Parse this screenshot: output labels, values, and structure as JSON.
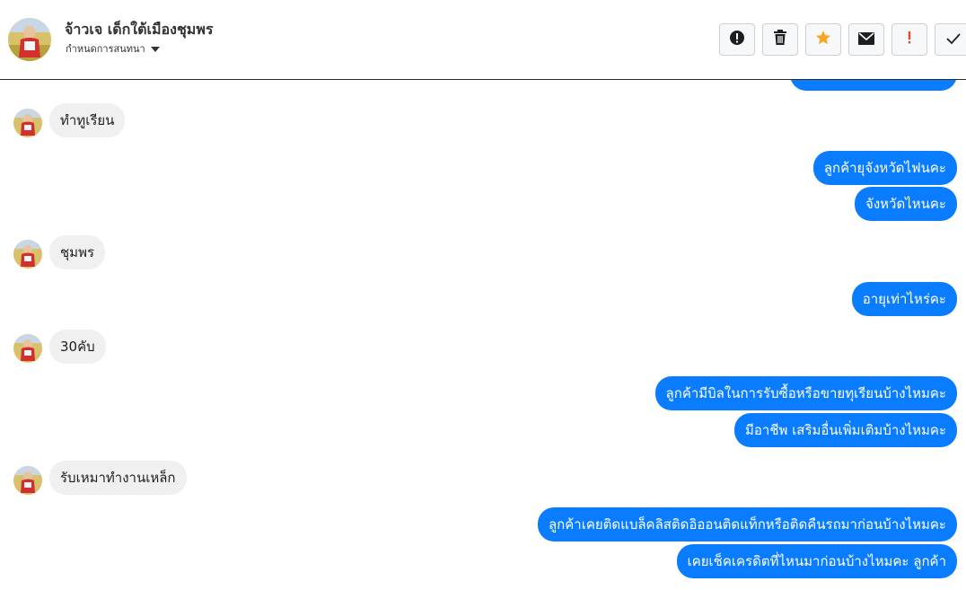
{
  "header": {
    "contact_name": "จ้าวเจ เด็กใต้เมืองชุมพร",
    "assign_label": "กำหนดการสนทนา"
  },
  "toolbar": {
    "buttons": [
      {
        "name": "alert-circle-icon"
      },
      {
        "name": "trash-icon"
      },
      {
        "name": "star-icon"
      },
      {
        "name": "envelope-icon"
      },
      {
        "name": "exclamation-icon"
      },
      {
        "name": "check-icon"
      }
    ]
  },
  "messages": [
    {
      "dir": "out",
      "text": ""
    },
    {
      "dir": "in",
      "text": "ทำทูเรียน"
    },
    {
      "dir": "out",
      "text": "ลูกค้ายุจังหวัดไฟนคะ"
    },
    {
      "dir": "out",
      "text": "จังหวัดไหนคะ"
    },
    {
      "dir": "in",
      "text": "ชุมพร"
    },
    {
      "dir": "out",
      "text": "อายุเท่าไหร่คะ"
    },
    {
      "dir": "in",
      "text": "30คับ"
    },
    {
      "dir": "out",
      "text": "ลูกค้ามีบิลในการรับซื้อหรือขายทุเรียนบ้างไหมคะ"
    },
    {
      "dir": "out",
      "text": "มีอาชีพ เสริมอื่นเพิ่มเติมบ้างไหมคะ"
    },
    {
      "dir": "in",
      "text": "รับเหมาทำงานเหล็ก"
    },
    {
      "dir": "out",
      "text": "ลูกค้าเคยติดแบล็คลิสติดอิออนติดแท็กหรือติดคืนรถมาก่อนบ้างไหมคะ"
    },
    {
      "dir": "out",
      "text": "เคยเช็คเครดิตที่ไหนมาก่อนบ้างไหมคะ ลูกค้า"
    }
  ],
  "colors": {
    "outgoing": "#0a7cff",
    "incoming": "#f0f0f0",
    "star": "#f5a623",
    "alert": "#e4472b"
  }
}
